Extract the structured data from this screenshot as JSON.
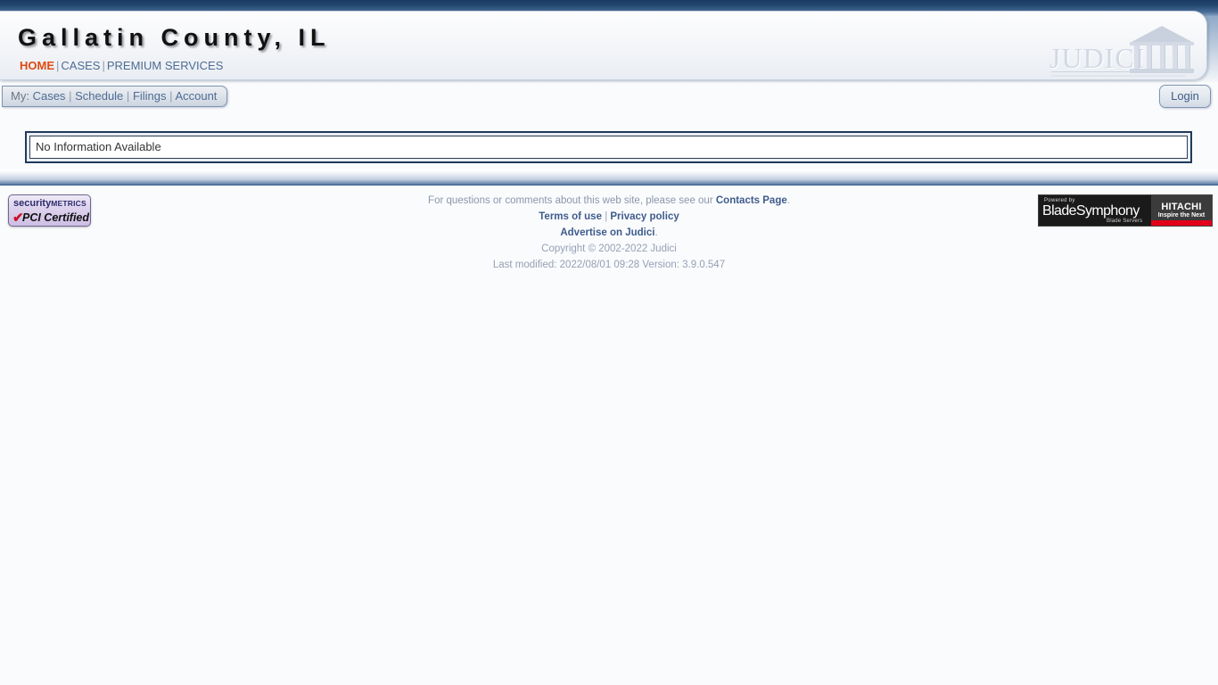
{
  "page": {
    "background_color": "#fafbfd"
  },
  "header": {
    "site_title": "Gallatin County, IL",
    "nav": {
      "home": "HOME",
      "cases": "CASES",
      "premium_services": "PREMIUM SERVICES",
      "separator": "|"
    },
    "logo": {
      "wordmark": "JUDICI",
      "icon": "courthouse-icon"
    },
    "accent_color": "#e04a12",
    "link_color": "#4e6c93"
  },
  "mynav": {
    "label": "My:",
    "items": [
      "Cases",
      "Schedule",
      "Filings",
      "Account"
    ],
    "separator": "|"
  },
  "login": {
    "label": "Login"
  },
  "main": {
    "message": "No Information Available"
  },
  "footer": {
    "questions_prefix": "For questions or comments about this web site, please see our ",
    "contacts_link": "Contacts Page",
    "questions_suffix": ".",
    "terms_of_use": "Terms of use",
    "separator": "|",
    "privacy_policy": "Privacy policy",
    "advertise": "Advertise on Judici",
    "advertise_suffix": ".",
    "copyright": "Copyright © 2002-2022 Judici",
    "last_modified": "Last modified: 2022/08/01 09:28 Version: 3.9.0.547",
    "link_color": "#3f5c8c",
    "text_color": "#8a97ab"
  },
  "badges": {
    "pci": {
      "brand_security": "security",
      "brand_metrics": "METRICS",
      "check": "✔",
      "certified": "PCI Certified"
    },
    "blade": {
      "powered_by": "Powered by",
      "product": "BladeSymphony",
      "subtitle": "Blade Servers",
      "vendor": "HITACHI",
      "tagline": "Inspire the Next",
      "accent_color": "#e3001b"
    }
  }
}
